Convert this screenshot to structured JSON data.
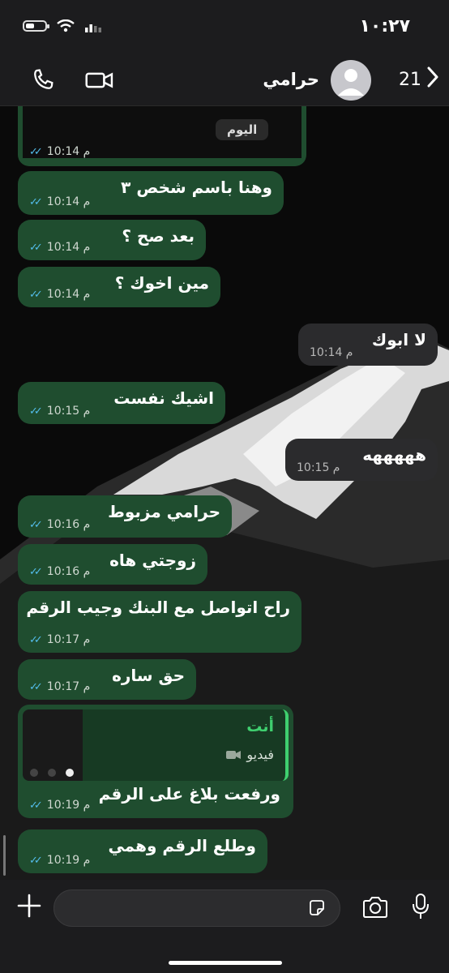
{
  "status_bar": {
    "time": "١٠:٢٧"
  },
  "header": {
    "back_count": "21",
    "contact_name": "حرامي",
    "icons": [
      "chevron-left-icon",
      "avatar-placeholder",
      "video-call-icon",
      "phone-call-icon"
    ]
  },
  "day_label": "اليوم",
  "first_card_time": "10:14 م",
  "messages": [
    {
      "dir": "in",
      "text": "وهنا باسم شخص ٣",
      "time": "10:14 م"
    },
    {
      "dir": "in",
      "text": "بعد صح ؟",
      "time": "10:14 م"
    },
    {
      "dir": "in",
      "text": "مين اخوك ؟",
      "time": "10:14 م"
    },
    {
      "dir": "out",
      "text": "لا ابوك",
      "time": "10:14 م"
    },
    {
      "dir": "in",
      "text": "اشيك نفست",
      "time": "10:15 م"
    },
    {
      "dir": "out",
      "text": "هههههه",
      "time": "10:15 م"
    },
    {
      "dir": "in",
      "text": "حرامي مزبوط",
      "time": "10:16 م"
    },
    {
      "dir": "in",
      "text": "زوجتي هاه",
      "time": "10:16 م"
    },
    {
      "dir": "in",
      "text": "راح اتواصل مع البنك وجيب الرقم",
      "time": "10:17 م"
    },
    {
      "dir": "in",
      "text": "حق ساره",
      "time": "10:17 م"
    },
    {
      "dir": "in",
      "text": "ورفعت بلاغ على الرقم",
      "time": "10:19 م",
      "reply_author": "أنت",
      "reply_type": "فيديو"
    },
    {
      "dir": "in",
      "text": "وطلع الرقم وهمي",
      "time": "10:19 م"
    }
  ],
  "colors": {
    "incoming_bubble": "#1f4d2f",
    "outgoing_bubble": "#2b2b2d",
    "read_ticks": "#53bdeb",
    "reply_accent": "#3fd06f"
  }
}
